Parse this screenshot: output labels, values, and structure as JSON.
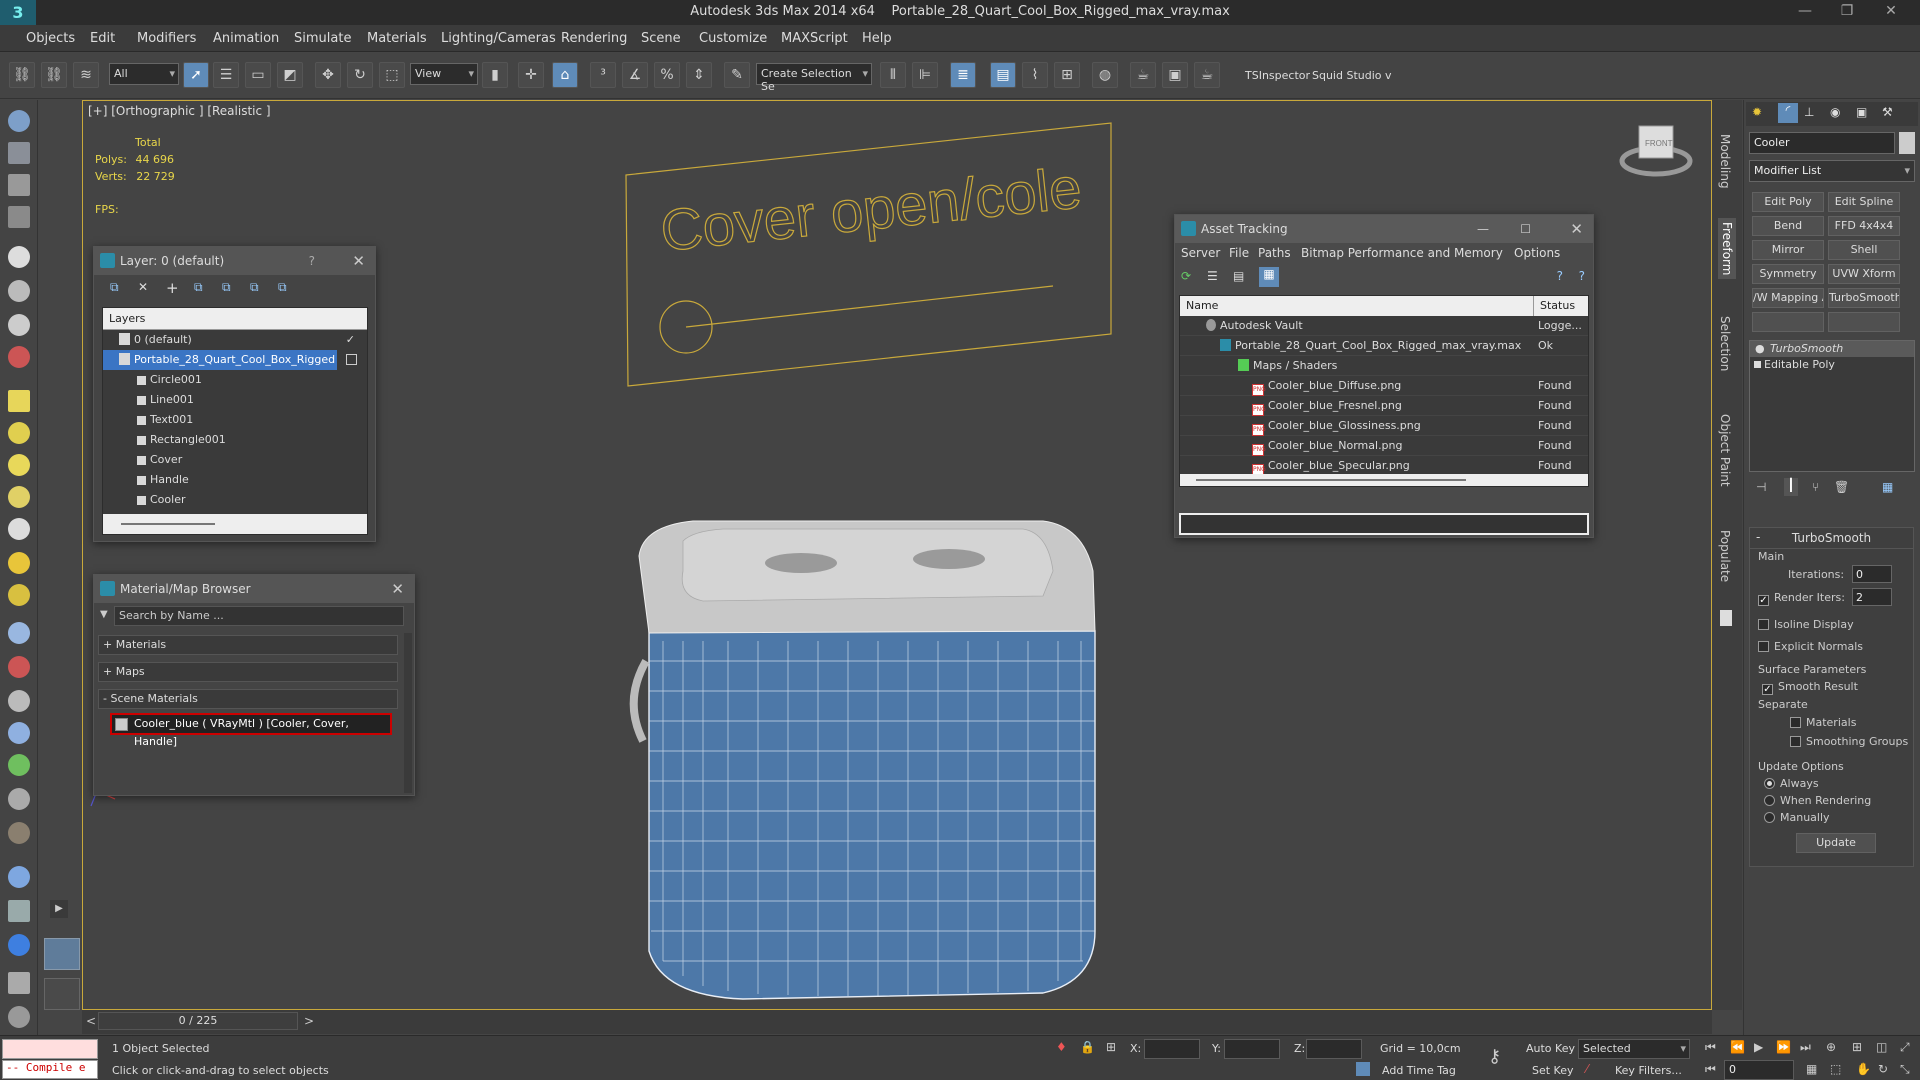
{
  "window": {
    "app": "Autodesk 3ds Max  2014 x64",
    "file": "Portable_28_Quart_Cool_Box_Rigged_max_vray.max"
  },
  "menu": [
    "Objects",
    "Edit",
    "Modifiers",
    "Animation",
    "Simulate",
    "Materials",
    "Lighting/Cameras",
    "Rendering",
    "Scene",
    "Customize",
    "MAXScript",
    "Help"
  ],
  "toolbar": {
    "filter": "All",
    "refcoord": "View",
    "selection_set": "Create Selection Se",
    "tsinspector": "TSInspector",
    "squid": "Squid Studio v"
  },
  "viewport": {
    "label": "[+] [Orthographic ] [Realistic ]",
    "stats": {
      "total_label": "Total",
      "polys_label": "Polys:",
      "polys": "44 696",
      "verts_label": "Verts:",
      "verts": "22 729",
      "fps_label": "FPS:"
    },
    "sign_text": "Cover open/cole",
    "viewcube": "FRONT"
  },
  "layer_dialog": {
    "title": "Layer: 0 (default)",
    "help": "?",
    "header": "Layers",
    "rows": [
      {
        "name": "0 (default)"
      },
      {
        "name": "Portable_28_Quart_Cool_Box_Rigged"
      },
      {
        "name": "Circle001"
      },
      {
        "name": "Line001"
      },
      {
        "name": "Text001"
      },
      {
        "name": "Rectangle001"
      },
      {
        "name": "Cover"
      },
      {
        "name": "Handle"
      },
      {
        "name": "Cooler"
      }
    ]
  },
  "material_browser": {
    "title": "Material/Map Browser",
    "search_placeholder": "Search by Name ...",
    "sections": [
      "+ Materials",
      "+ Maps",
      "- Scene Materials"
    ],
    "item": "Cooler_blue  ( VRayMtl ) [Cooler, Cover, Handle]"
  },
  "asset_tracking": {
    "title": "Asset Tracking",
    "menu": [
      "Server",
      "File",
      "Paths",
      "Bitmap Performance and Memory",
      "Options"
    ],
    "col_name": "Name",
    "col_status": "Status",
    "rows": [
      {
        "name": "Autodesk Vault",
        "status": "Logge..."
      },
      {
        "name": "Portable_28_Quart_Cool_Box_Rigged_max_vray.max",
        "status": "Ok"
      },
      {
        "name": "Maps / Shaders",
        "status": ""
      },
      {
        "name": "Cooler_blue_Diffuse.png",
        "status": "Found"
      },
      {
        "name": "Cooler_blue_Fresnel.png",
        "status": "Found"
      },
      {
        "name": "Cooler_blue_Glossiness.png",
        "status": "Found"
      },
      {
        "name": "Cooler_blue_Normal.png",
        "status": "Found"
      },
      {
        "name": "Cooler_blue_Specular.png",
        "status": "Found"
      }
    ]
  },
  "command_panel": {
    "object_name": "Cooler",
    "modifier_list": "Modifier List",
    "buttons": [
      "Edit Poly",
      "Edit Spline",
      "Bend",
      "FFD 4x4x4",
      "Mirror",
      "Shell",
      "Symmetry",
      "UVW Xform",
      "/W Mapping Ac",
      "TurboSmooth"
    ],
    "stack": [
      "TurboSmooth",
      "Editable Poly"
    ],
    "turbosmooth": {
      "title": "TurboSmooth",
      "main": "Main",
      "iterations_label": "Iterations:",
      "iterations": "0",
      "render_iters_label": "Render Iters:",
      "render_iters": "2",
      "isoline": "Isoline Display",
      "explicit": "Explicit Normals",
      "surface": "Surface Parameters",
      "smooth_result": "Smooth Result",
      "separate": "Separate",
      "materials": "Materials",
      "smoothing_groups": "Smoothing Groups",
      "update_options": "Update Options",
      "always": "Always",
      "when_rendering": "When Rendering",
      "manually": "Manually",
      "update": "Update"
    }
  },
  "side_tabs": [
    "Modeling",
    "Freeform",
    "Selection",
    "Object Paint",
    "Populate"
  ],
  "timeline": {
    "frame": "0 / 225"
  },
  "status": {
    "listener": "-- Compile e",
    "selected": "1 Object Selected",
    "prompt": "Click or click-and-drag to select objects",
    "x_label": "X:",
    "y_label": "Y:",
    "z_label": "Z:",
    "grid": "Grid = 10,0cm",
    "add_time_tag": "Add Time Tag",
    "auto_key": "Auto Key",
    "set_key": "Set Key",
    "selected_dd": "Selected",
    "key_filters": "Key Filters...",
    "frame_field": "0"
  }
}
